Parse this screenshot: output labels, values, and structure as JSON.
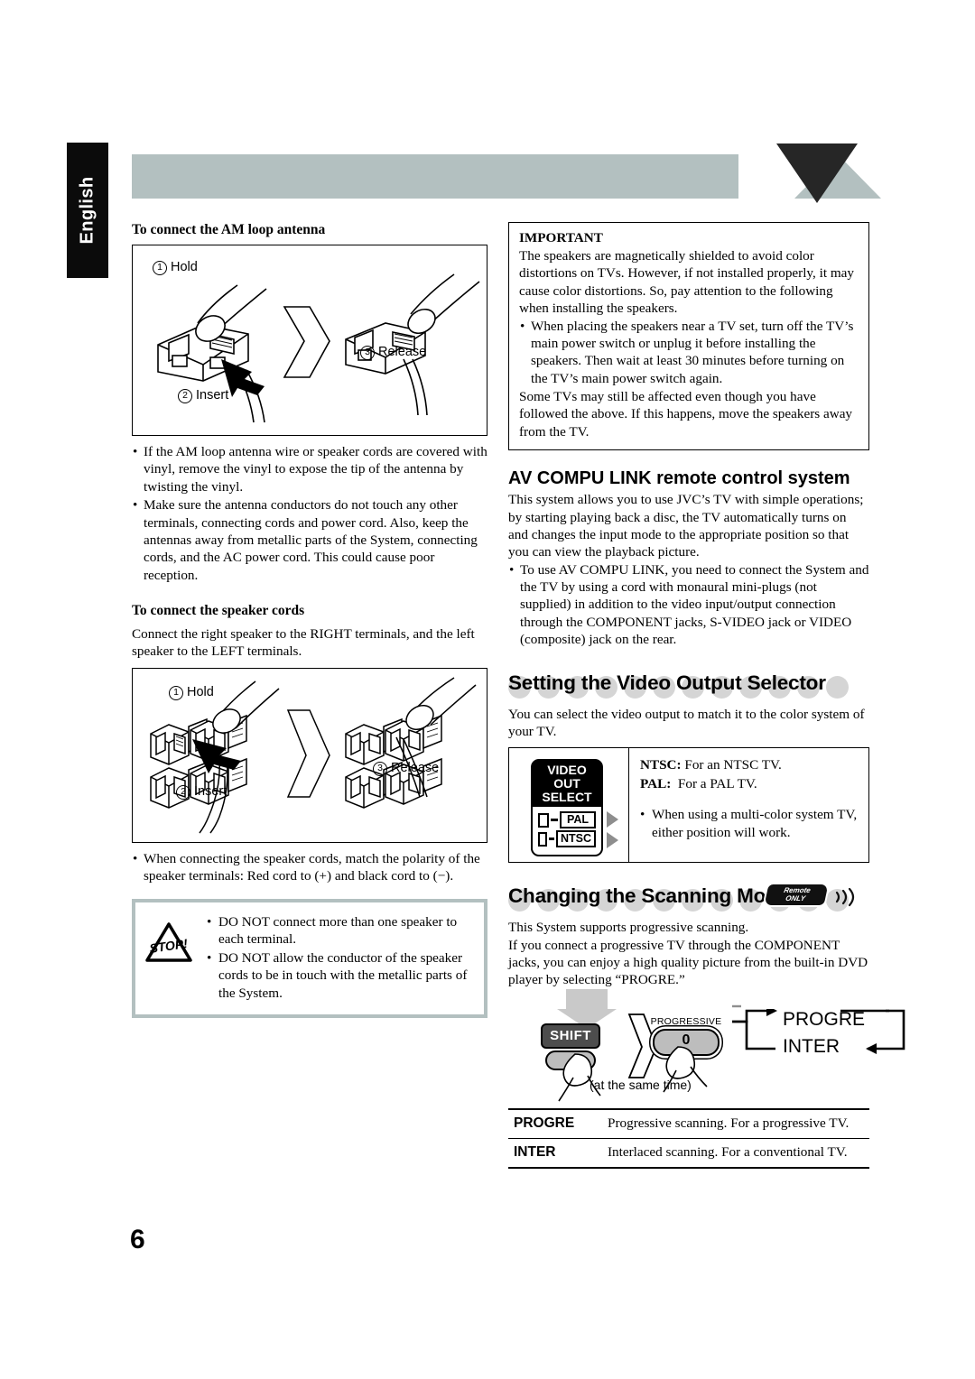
{
  "page": {
    "language_tab": "English",
    "page_number": "6"
  },
  "left_column": {
    "am_antenna_heading": "To connect the AM loop antenna",
    "am_figure": {
      "step1_num": "1",
      "step1_label": "Hold",
      "step2_num": "2",
      "step2_label": "Insert",
      "step3_num": "3",
      "step3_label": "Release"
    },
    "antenna_bullets": [
      "If the AM loop antenna wire or speaker cords are covered with vinyl, remove the vinyl to expose the tip of the antenna by twisting the vinyl.",
      "Make sure the antenna conductors do not touch any other terminals, connecting cords and power cord. Also, keep the antennas away from metallic parts of the System, connecting cords, and the AC power cord. This could cause poor reception."
    ],
    "speaker_heading": "To connect the speaker cords",
    "speaker_intro": "Connect the right speaker to the RIGHT terminals, and the left speaker to the LEFT terminals.",
    "speaker_figure": {
      "step1_num": "1",
      "step1_label": "Hold",
      "step2_num": "2",
      "step2_label": "Insert",
      "step3_num": "3",
      "step3_label": "Release"
    },
    "polarity_bullet": "When connecting the speaker cords, match the polarity of the speaker terminals: Red cord to (+) and black cord to (−).",
    "caution": {
      "icon_text": "STOP!",
      "items": [
        "DO NOT connect more than one speaker to each terminal.",
        "DO NOT allow the conductor of the speaker cords to be in touch with the metallic parts of the System."
      ]
    }
  },
  "right_column": {
    "important": {
      "title": "IMPORTANT",
      "paragraph1": "The speakers are magnetically shielded to avoid color distortions on TVs. However, if not installed properly, it may cause color distortions. So, pay attention to the following when installing the speakers.",
      "bullet1": "When placing the speakers near a TV set, turn off the TV’s main power switch or unplug it before installing the speakers. Then wait at least 30 minutes before turning on the TV’s main power switch again.",
      "paragraph2": "Some TVs may still be affected even though you have followed the above. If this happens, move the speakers away from the TV."
    },
    "av_compu_link": {
      "heading": "AV COMPU LINK remote control system",
      "paragraph": "This system allows you to use JVC’s TV with simple operations; by starting playing back a disc, the TV automatically turns on and changes the input mode to the appropriate position so that you can view the playback picture.",
      "bullet": "To use AV COMPU LINK, you need to connect the System and the TV by using a cord with monaural mini-plugs (not supplied) in addition to the video input/output connection through the COMPONENT jacks, S-VIDEO jack or VIDEO (composite) jack on the rear."
    },
    "video_output": {
      "heading": "Setting the Video Output Selector",
      "intro": "You can select the video output to match it to the color system of your TV.",
      "switch": {
        "cap_line1": "VIDEO",
        "cap_line2": "OUT",
        "cap_line3": "SELECT",
        "option_pal": "PAL",
        "option_ntsc": "NTSC"
      },
      "ntsc_key": "NTSC:",
      "ntsc_desc": "For an NTSC TV.",
      "pal_key": "PAL:",
      "pal_desc": "For a PAL TV.",
      "note": "When using a multi-color system TV, either position will work."
    },
    "scanning_mode": {
      "heading": "Changing the Scanning Mode",
      "badge_line1": "Remote",
      "badge_line2": "ONLY",
      "wave_icon": "⦷",
      "paragraph1": "This System supports progressive scanning.",
      "paragraph2": "If you connect a progressive TV through the COMPONENT jacks, you can enjoy a high quality picture from the built-in DVD player by selecting “PROGRE.”",
      "diagram": {
        "shift_key": "SHIFT",
        "progressive_label": "PROGRESSIVE",
        "progressive_key": "0",
        "same_time": "(at the same time)",
        "cycle_top": "PROGRE",
        "cycle_bottom": "INTER"
      },
      "table": [
        {
          "mode": "PROGRE",
          "desc": "Progressive scanning. For a progressive TV."
        },
        {
          "mode": "INTER",
          "desc": "Interlaced scanning. For a conventional TV."
        }
      ]
    }
  },
  "colors": {
    "band_gray": "#b3c0c0",
    "dot_gray": "#d5d5d5",
    "black": "#000000"
  }
}
